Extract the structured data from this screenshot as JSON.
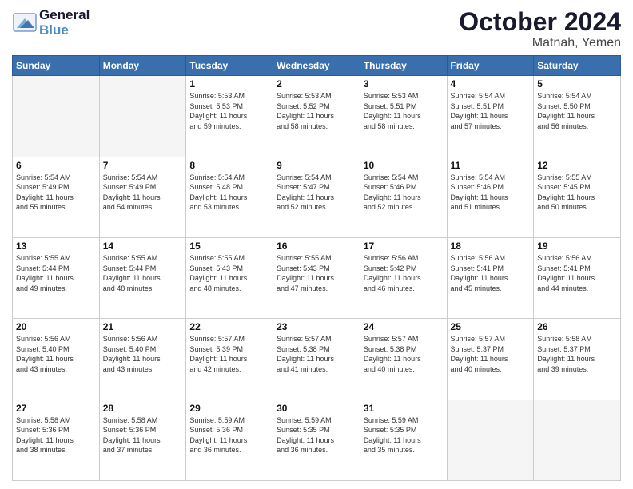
{
  "header": {
    "logo_general": "General",
    "logo_blue": "Blue",
    "month_title": "October 2024",
    "location": "Matnah, Yemen"
  },
  "weekdays": [
    "Sunday",
    "Monday",
    "Tuesday",
    "Wednesday",
    "Thursday",
    "Friday",
    "Saturday"
  ],
  "weeks": [
    [
      {
        "day": "",
        "info": ""
      },
      {
        "day": "",
        "info": ""
      },
      {
        "day": "1",
        "info": "Sunrise: 5:53 AM\nSunset: 5:53 PM\nDaylight: 11 hours\nand 59 minutes."
      },
      {
        "day": "2",
        "info": "Sunrise: 5:53 AM\nSunset: 5:52 PM\nDaylight: 11 hours\nand 58 minutes."
      },
      {
        "day": "3",
        "info": "Sunrise: 5:53 AM\nSunset: 5:51 PM\nDaylight: 11 hours\nand 58 minutes."
      },
      {
        "day": "4",
        "info": "Sunrise: 5:54 AM\nSunset: 5:51 PM\nDaylight: 11 hours\nand 57 minutes."
      },
      {
        "day": "5",
        "info": "Sunrise: 5:54 AM\nSunset: 5:50 PM\nDaylight: 11 hours\nand 56 minutes."
      }
    ],
    [
      {
        "day": "6",
        "info": "Sunrise: 5:54 AM\nSunset: 5:49 PM\nDaylight: 11 hours\nand 55 minutes."
      },
      {
        "day": "7",
        "info": "Sunrise: 5:54 AM\nSunset: 5:49 PM\nDaylight: 11 hours\nand 54 minutes."
      },
      {
        "day": "8",
        "info": "Sunrise: 5:54 AM\nSunset: 5:48 PM\nDaylight: 11 hours\nand 53 minutes."
      },
      {
        "day": "9",
        "info": "Sunrise: 5:54 AM\nSunset: 5:47 PM\nDaylight: 11 hours\nand 52 minutes."
      },
      {
        "day": "10",
        "info": "Sunrise: 5:54 AM\nSunset: 5:46 PM\nDaylight: 11 hours\nand 52 minutes."
      },
      {
        "day": "11",
        "info": "Sunrise: 5:54 AM\nSunset: 5:46 PM\nDaylight: 11 hours\nand 51 minutes."
      },
      {
        "day": "12",
        "info": "Sunrise: 5:55 AM\nSunset: 5:45 PM\nDaylight: 11 hours\nand 50 minutes."
      }
    ],
    [
      {
        "day": "13",
        "info": "Sunrise: 5:55 AM\nSunset: 5:44 PM\nDaylight: 11 hours\nand 49 minutes."
      },
      {
        "day": "14",
        "info": "Sunrise: 5:55 AM\nSunset: 5:44 PM\nDaylight: 11 hours\nand 48 minutes."
      },
      {
        "day": "15",
        "info": "Sunrise: 5:55 AM\nSunset: 5:43 PM\nDaylight: 11 hours\nand 48 minutes."
      },
      {
        "day": "16",
        "info": "Sunrise: 5:55 AM\nSunset: 5:43 PM\nDaylight: 11 hours\nand 47 minutes."
      },
      {
        "day": "17",
        "info": "Sunrise: 5:56 AM\nSunset: 5:42 PM\nDaylight: 11 hours\nand 46 minutes."
      },
      {
        "day": "18",
        "info": "Sunrise: 5:56 AM\nSunset: 5:41 PM\nDaylight: 11 hours\nand 45 minutes."
      },
      {
        "day": "19",
        "info": "Sunrise: 5:56 AM\nSunset: 5:41 PM\nDaylight: 11 hours\nand 44 minutes."
      }
    ],
    [
      {
        "day": "20",
        "info": "Sunrise: 5:56 AM\nSunset: 5:40 PM\nDaylight: 11 hours\nand 43 minutes."
      },
      {
        "day": "21",
        "info": "Sunrise: 5:56 AM\nSunset: 5:40 PM\nDaylight: 11 hours\nand 43 minutes."
      },
      {
        "day": "22",
        "info": "Sunrise: 5:57 AM\nSunset: 5:39 PM\nDaylight: 11 hours\nand 42 minutes."
      },
      {
        "day": "23",
        "info": "Sunrise: 5:57 AM\nSunset: 5:38 PM\nDaylight: 11 hours\nand 41 minutes."
      },
      {
        "day": "24",
        "info": "Sunrise: 5:57 AM\nSunset: 5:38 PM\nDaylight: 11 hours\nand 40 minutes."
      },
      {
        "day": "25",
        "info": "Sunrise: 5:57 AM\nSunset: 5:37 PM\nDaylight: 11 hours\nand 40 minutes."
      },
      {
        "day": "26",
        "info": "Sunrise: 5:58 AM\nSunset: 5:37 PM\nDaylight: 11 hours\nand 39 minutes."
      }
    ],
    [
      {
        "day": "27",
        "info": "Sunrise: 5:58 AM\nSunset: 5:36 PM\nDaylight: 11 hours\nand 38 minutes."
      },
      {
        "day": "28",
        "info": "Sunrise: 5:58 AM\nSunset: 5:36 PM\nDaylight: 11 hours\nand 37 minutes."
      },
      {
        "day": "29",
        "info": "Sunrise: 5:59 AM\nSunset: 5:36 PM\nDaylight: 11 hours\nand 36 minutes."
      },
      {
        "day": "30",
        "info": "Sunrise: 5:59 AM\nSunset: 5:35 PM\nDaylight: 11 hours\nand 36 minutes."
      },
      {
        "day": "31",
        "info": "Sunrise: 5:59 AM\nSunset: 5:35 PM\nDaylight: 11 hours\nand 35 minutes."
      },
      {
        "day": "",
        "info": ""
      },
      {
        "day": "",
        "info": ""
      }
    ]
  ]
}
